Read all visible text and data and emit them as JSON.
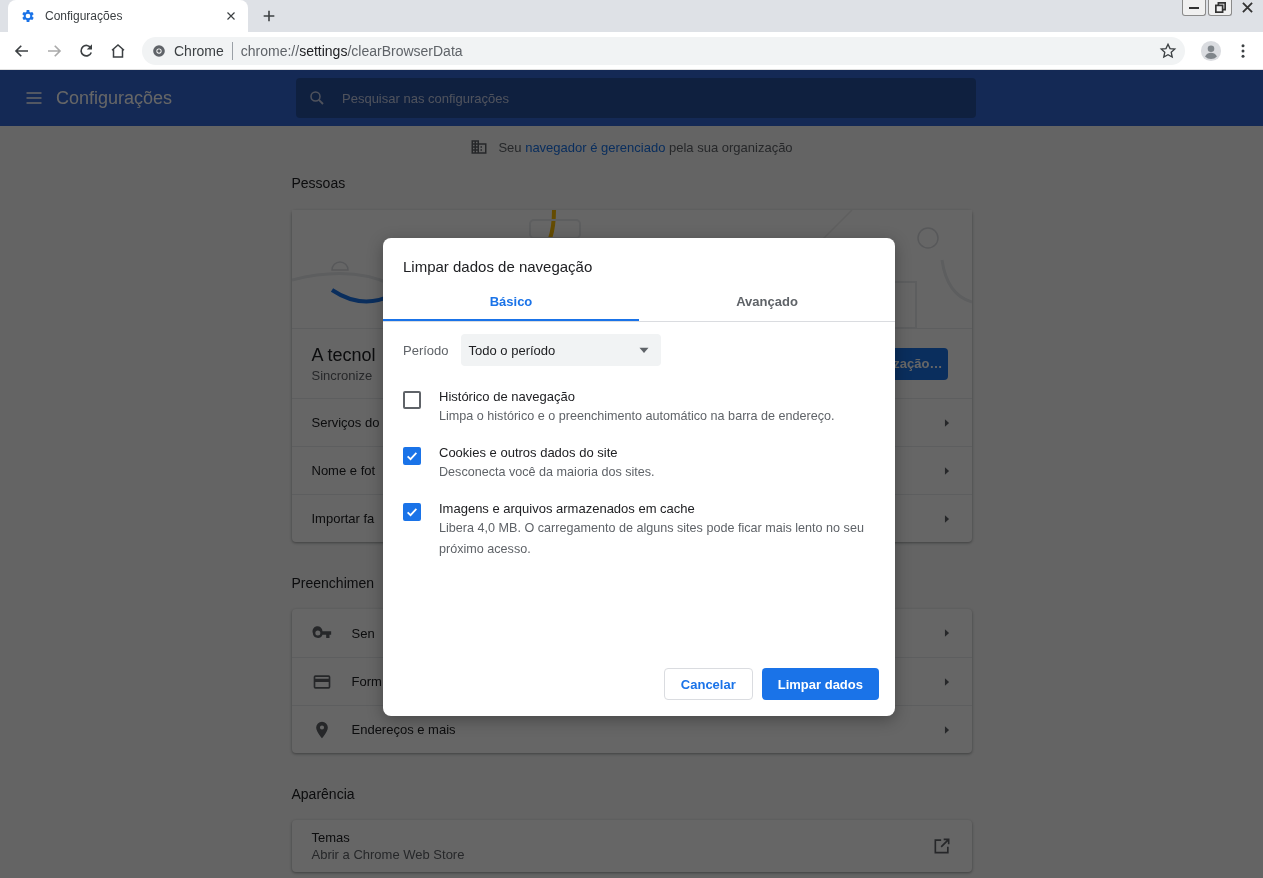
{
  "browser": {
    "tabs": [
      {
        "title": "Configurações",
        "selected": true
      }
    ],
    "address": {
      "site_label": "Chrome",
      "url_scheme": "chrome://",
      "url_host": "settings",
      "url_path": "/clearBrowserData"
    }
  },
  "settings": {
    "title": "Configurações",
    "search": {
      "placeholder": "Pesquisar nas configurações"
    },
    "managed_notice": {
      "before": "Seu",
      "link": "navegador é gerenciado",
      "after": "pela sua organização"
    },
    "sections": [
      {
        "title": "Pessoas",
        "banner": true,
        "rows": [
          {
            "kind": "profile",
            "title": "A tecnol",
            "subtitle": "Sincronize",
            "button": "zação…"
          },
          {
            "kind": "link",
            "label": "Serviços do"
          },
          {
            "kind": "link",
            "label": "Nome e fot"
          },
          {
            "kind": "link",
            "label": "Importar fa"
          }
        ]
      },
      {
        "title": "Preenchimen",
        "banner": false,
        "rows": [
          {
            "kind": "icon-link",
            "label": "Sen"
          },
          {
            "kind": "icon-link",
            "label": "Form"
          },
          {
            "kind": "icon-link",
            "label": "Endereços e mais"
          }
        ]
      },
      {
        "title": "Aparência",
        "banner": false,
        "rows": [
          {
            "kind": "external",
            "title": "Temas",
            "subtitle": "Abrir a Chrome Web Store"
          }
        ]
      }
    ]
  },
  "dialog": {
    "title": "Limpar dados de navegação",
    "tabs": [
      {
        "label": "Básico",
        "selected": true
      },
      {
        "label": "Avançado",
        "selected": false
      }
    ],
    "period": {
      "label": "Período",
      "value": "Todo o período"
    },
    "options": [
      {
        "title": "Histórico de navegação",
        "description": "Limpa o histórico e o preenchimento automático na barra de endereço.",
        "checked": false
      },
      {
        "title": "Cookies e outros dados do site",
        "description": "Desconecta você da maioria dos sites.",
        "checked": true
      },
      {
        "title": "Imagens e arquivos armazenados em cache",
        "description": "Libera 4,0 MB. O carregamento de alguns sites pode ficar mais lento no seu próximo acesso.",
        "checked": true
      }
    ],
    "buttons": [
      {
        "label": "Cancelar",
        "kind": "secondary"
      },
      {
        "label": "Limpar dados",
        "kind": "primary"
      }
    ]
  }
}
